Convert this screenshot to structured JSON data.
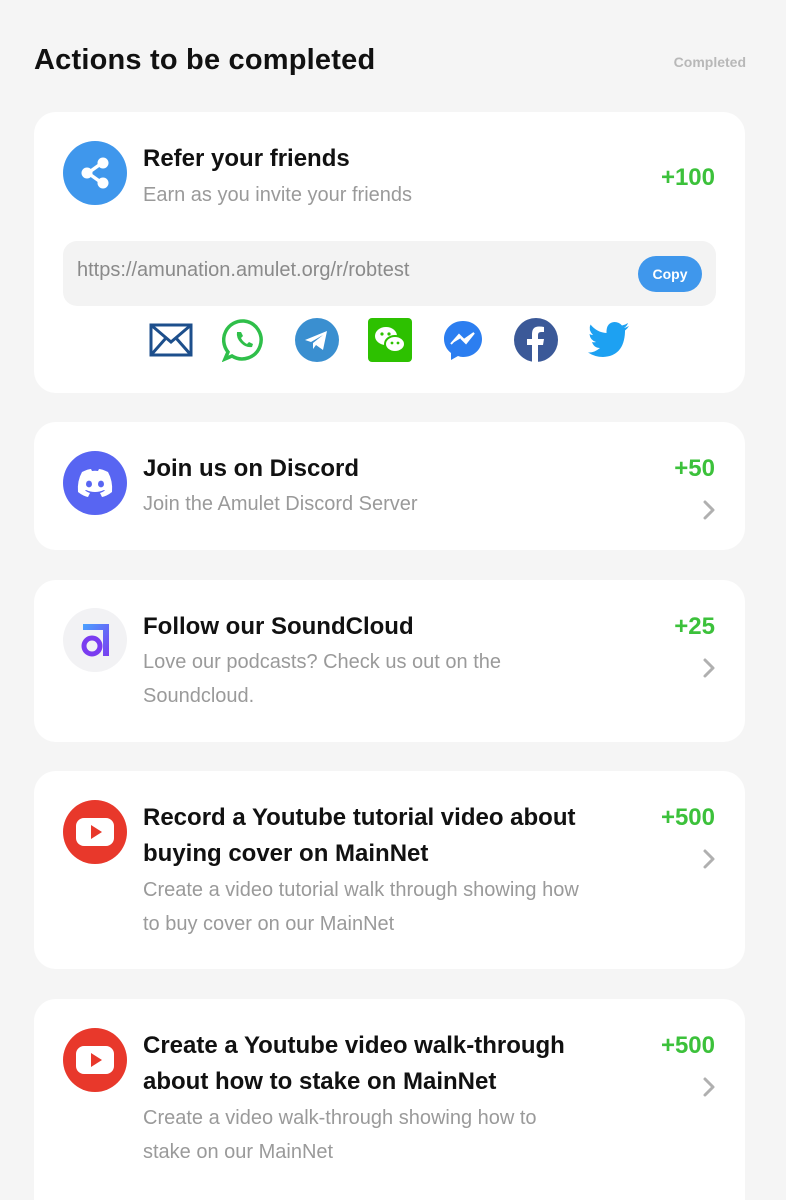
{
  "header": {
    "title": "Actions to be completed",
    "link": "Completed"
  },
  "colors": {
    "points": "#3cc13b",
    "accent": "#3f97ec",
    "discord": "#5865f2",
    "youtube": "#e8382b"
  },
  "refer": {
    "title": "Refer your friends",
    "desc": "Earn as you invite your friends",
    "points": "+100",
    "link": "https://amunation.amulet.org/r/robtest",
    "copy_label": "Copy",
    "share_icons": [
      "email-icon",
      "whatsapp-icon",
      "telegram-icon",
      "wechat-icon",
      "messenger-icon",
      "facebook-icon",
      "twitter-icon"
    ]
  },
  "discord": {
    "title": "Join us on Discord",
    "desc": "Join the Amulet Discord Server",
    "points": "+50"
  },
  "soundcloud": {
    "title": "Follow our SoundCloud",
    "desc1": "Love our podcasts? Check us out on the",
    "desc2": "Soundcloud.",
    "points": "+25"
  },
  "yt1": {
    "title1": "Record a Youtube tutorial video about",
    "title2": "buying cover on MainNet",
    "desc1": "Create a video tutorial walk through showing how",
    "desc2": "to buy cover on our MainNet",
    "points": "+500"
  },
  "yt2": {
    "title1": "Create a Youtube video walk-through",
    "title2": "about how to stake on MainNet",
    "desc1": "Create a video walk-through showing how to",
    "desc2": "stake on our MainNet",
    "points": "+500"
  }
}
